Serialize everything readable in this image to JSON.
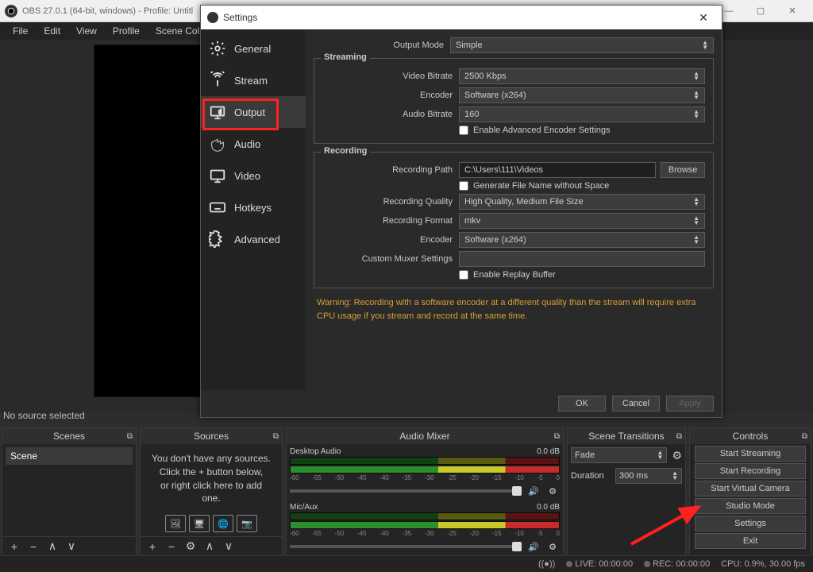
{
  "window": {
    "title": "OBS 27.0.1 (64-bit, windows) - Profile: Untitl"
  },
  "menubar": [
    "File",
    "Edit",
    "View",
    "Profile",
    "Scene Collection"
  ],
  "nosource_text": "No source selected",
  "panels": {
    "scenes": {
      "title": "Scenes",
      "items": [
        "Scene"
      ]
    },
    "sources": {
      "title": "Sources",
      "empty_lines": [
        "You don't have any sources.",
        "Click the + button below,",
        "or right click here to add one."
      ]
    },
    "mixer": {
      "title": "Audio Mixer",
      "tracks": [
        {
          "name": "Desktop Audio",
          "db": "0.0 dB",
          "ticks": [
            "-60",
            "-55",
            "-50",
            "-45",
            "-40",
            "-35",
            "-30",
            "-25",
            "-20",
            "-15",
            "-10",
            "-5",
            "0"
          ]
        },
        {
          "name": "Mic/Aux",
          "db": "0.0 dB",
          "ticks": [
            "-60",
            "-55",
            "-50",
            "-45",
            "-40",
            "-35",
            "-30",
            "-25",
            "-20",
            "-15",
            "-10",
            "-5",
            "0"
          ]
        }
      ]
    },
    "transitions": {
      "title": "Scene Transitions",
      "mode": "Fade",
      "dur_label": "Duration",
      "dur_value": "300 ms"
    },
    "controls": {
      "title": "Controls",
      "buttons": [
        "Start Streaming",
        "Start Recording",
        "Start Virtual Camera",
        "Studio Mode",
        "Settings",
        "Exit"
      ]
    }
  },
  "statusbar": {
    "live": "LIVE: 00:00:00",
    "rec": "REC: 00:00:00",
    "cpu": "CPU: 0.9%, 30.00 fps"
  },
  "settings": {
    "title": "Settings",
    "nav": [
      "General",
      "Stream",
      "Output",
      "Audio",
      "Video",
      "Hotkeys",
      "Advanced"
    ],
    "active_nav_index": 2,
    "output_mode_label": "Output Mode",
    "output_mode_value": "Simple",
    "streaming": {
      "legend": "Streaming",
      "video_bitrate_label": "Video Bitrate",
      "video_bitrate_value": "2500 Kbps",
      "encoder_label": "Encoder",
      "encoder_value": "Software (x264)",
      "audio_bitrate_label": "Audio Bitrate",
      "audio_bitrate_value": "160",
      "adv_enc_label": "Enable Advanced Encoder Settings"
    },
    "recording": {
      "legend": "Recording",
      "path_label": "Recording Path",
      "path_value": "C:\\Users\\111\\Videos",
      "browse": "Browse",
      "gen_nospace_label": "Generate File Name without Space",
      "quality_label": "Recording Quality",
      "quality_value": "High Quality, Medium File Size",
      "format_label": "Recording Format",
      "format_value": "mkv",
      "encoder_label": "Encoder",
      "encoder_value": "Software (x264)",
      "muxer_label": "Custom Muxer Settings",
      "muxer_value": "",
      "replay_label": "Enable Replay Buffer"
    },
    "warning": "Warning: Recording with a software encoder at a different quality than the stream will require extra CPU usage if you stream and record at the same time.",
    "buttons": {
      "ok": "OK",
      "cancel": "Cancel",
      "apply": "Apply"
    }
  }
}
